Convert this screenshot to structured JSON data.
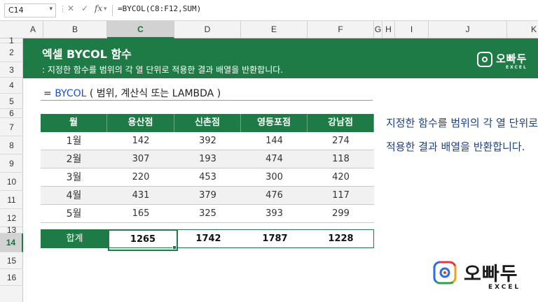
{
  "formula_bar": {
    "name_box": "C14",
    "cancel_icon": "x-icon",
    "enter_icon": "check-icon",
    "fx_label": "fx",
    "formula": "=BYCOL(C8:F12,SUM)"
  },
  "columns": [
    "A",
    "B",
    "C",
    "D",
    "E",
    "F",
    "G",
    "H",
    "I",
    "J",
    "K"
  ],
  "selected_column": "C",
  "rows": [
    "1",
    "2",
    "3",
    "4",
    "5",
    "6",
    "7",
    "8",
    "9",
    "10",
    "11",
    "12",
    "13",
    "14",
    "15",
    "16"
  ],
  "selected_row": "14",
  "banner": {
    "title": "엑셀 BYCOL 함수",
    "subtitle": ": 지정한 함수를 범위의 각 열 단위로 적용한 결과 배열을 반환합니다.",
    "logo_text": "오빠두",
    "logo_sub": "EXCEL",
    "color": "#1e7b45"
  },
  "syntax": {
    "prefix": "= ",
    "function": "BYCOL",
    "args": " ( 범위, 계산식 또는 LAMBDA )"
  },
  "table": {
    "headers": [
      "월",
      "용산점",
      "신촌점",
      "영등포점",
      "강남점"
    ],
    "rows": [
      [
        "1월",
        "142",
        "392",
        "144",
        "274"
      ],
      [
        "2월",
        "307",
        "193",
        "474",
        "118"
      ],
      [
        "3월",
        "220",
        "453",
        "300",
        "420"
      ],
      [
        "4월",
        "431",
        "379",
        "476",
        "117"
      ],
      [
        "5월",
        "165",
        "325",
        "393",
        "299"
      ]
    ],
    "total_label": "합계",
    "totals": [
      "1265",
      "1742",
      "1787",
      "1228"
    ]
  },
  "description": {
    "line1": "지정한 함수를 범위의 각 열 단위로",
    "line2": "적용한 결과 배열을 반환합니다."
  },
  "footer_logo": {
    "text": "오빠두",
    "sub": "EXCEL"
  }
}
